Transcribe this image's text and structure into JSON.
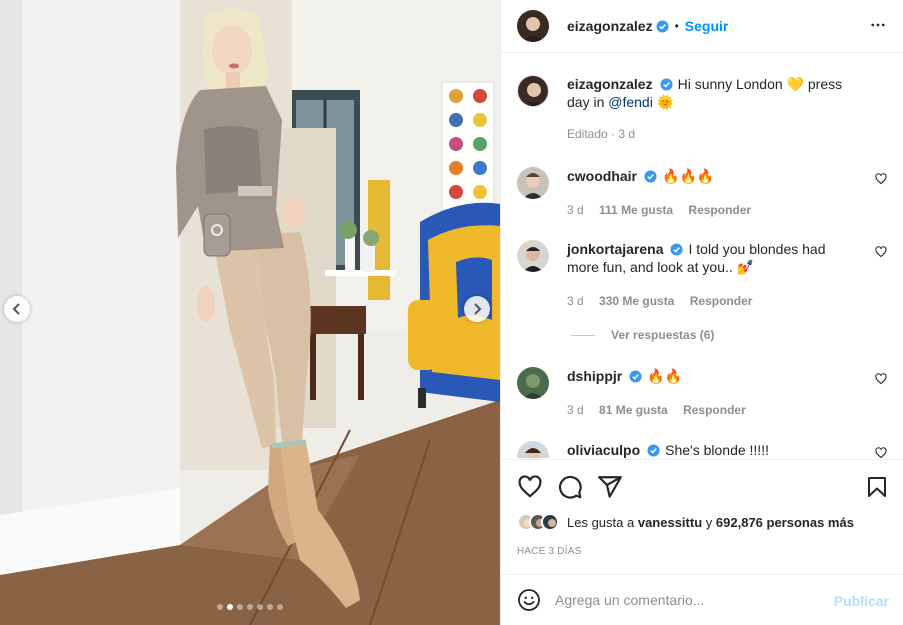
{
  "post": {
    "author": "eizagonzalez",
    "follow_label": "Seguir",
    "bullet": "•",
    "caption_text": "Hi sunny London 💛 press day in",
    "caption_mention": "@fendi",
    "caption_end": "🌞",
    "caption_meta": "Editado · 3 d"
  },
  "comments": [
    {
      "user": "cwoodhair",
      "text": "🔥🔥🔥",
      "time": "3 d",
      "likes": "111 Me gusta",
      "reply": "Responder"
    },
    {
      "user": "jonkortajarena",
      "text": "I told you blondes had more fun, and look at you.. 💅",
      "time": "3 d",
      "likes": "330 Me gusta",
      "reply": "Responder"
    },
    {
      "user": "dshippjr",
      "text": "🔥🔥",
      "time": "3 d",
      "likes": "81 Me gusta",
      "reply": "Responder"
    },
    {
      "user": "oliviaculpo",
      "text": "She's blonde !!!!!"
    }
  ],
  "view_replies": "Ver respuestas (6)",
  "likes": {
    "prefix": "Les gusta a",
    "user": "vanessittu",
    "middle": "y",
    "count": "692,876 personas más"
  },
  "time_ago": "HACE 3 DÍAS",
  "composer": {
    "placeholder": "Agrega un comentario...",
    "post_label": "Publicar"
  },
  "carousel": {
    "total": 7,
    "active": 2
  },
  "colors": {
    "accent": "#0095f6",
    "post_disabled": "#b2dffc",
    "mention": "#00376b",
    "muted": "#8e8e8e"
  },
  "icons": [
    "heart-icon",
    "comment-icon",
    "share-icon",
    "bookmark-icon",
    "more-icon",
    "emoji-icon",
    "verified-badge-icon",
    "chevron-left-icon",
    "chevron-right-icon"
  ]
}
